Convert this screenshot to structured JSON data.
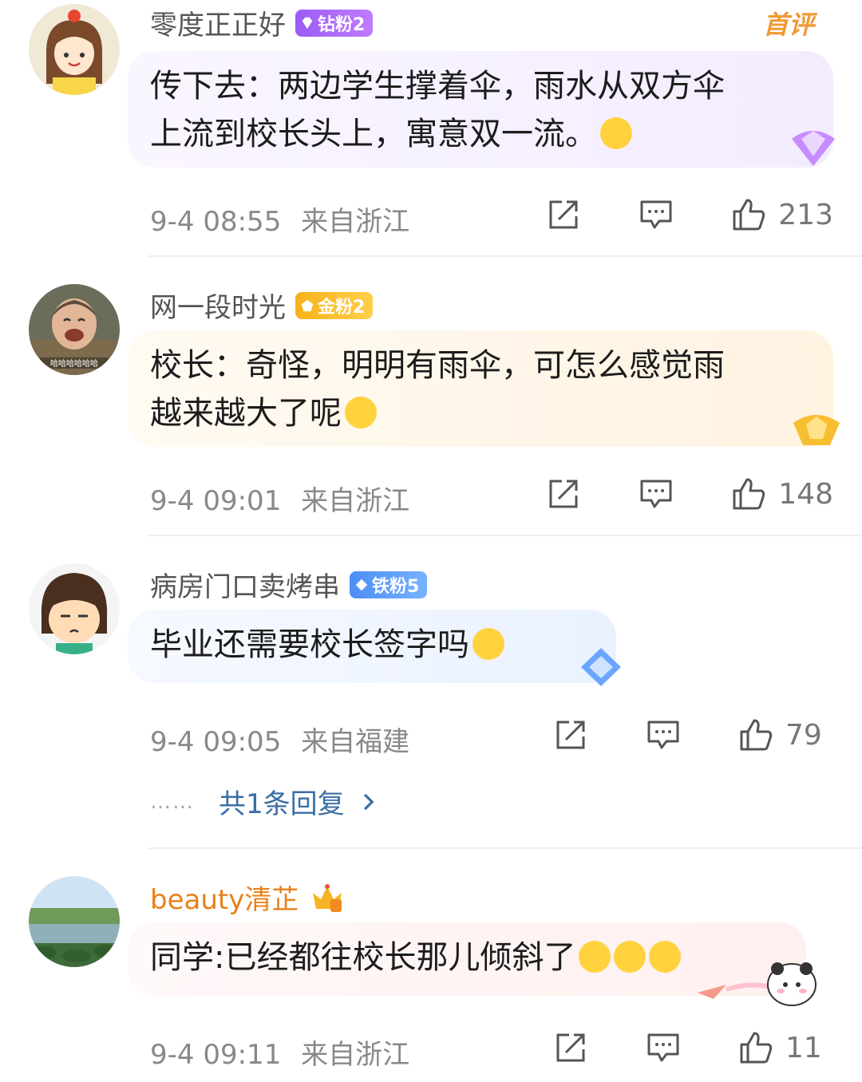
{
  "first_tag": "首评",
  "comments": [
    {
      "username": "零度正正好",
      "badge": "钻粉2",
      "text_line1": "传下去：两边学生撑着伞，雨水从双方伞",
      "text_line2": "上流到校长头上，寓意双一流。",
      "time": "9-4 08:55",
      "location": "来自浙江",
      "likes": "213"
    },
    {
      "username": "网一段时光",
      "badge": "金粉2",
      "text_line1": "校长：奇怪，明明有雨伞，可怎么感觉雨",
      "text_line2": "越来越大了呢",
      "time": "9-4 09:01",
      "location": "来自浙江",
      "likes": "148"
    },
    {
      "username": "病房门口卖烤串",
      "badge": "铁粉5",
      "text_line1": "毕业还需要校长签字吗",
      "time": "9-4 09:05",
      "location": "来自福建",
      "likes": "79",
      "replies": "共1条回复",
      "reply_dots": "……"
    },
    {
      "username": "beauty清芷",
      "text_line1": "同学:已经都往校长那儿倾斜了",
      "time": "9-4 09:11",
      "location": "来自浙江",
      "likes": "11"
    }
  ],
  "avatar_caption_2": "哈哈哈哈哈哈",
  "colors": {
    "vip_name": "#e8801a",
    "reply_link": "#3a6ea5",
    "meta": "#888888"
  },
  "icons": [
    "share-icon",
    "comment-icon",
    "like-icon",
    "chevron-right-icon"
  ]
}
